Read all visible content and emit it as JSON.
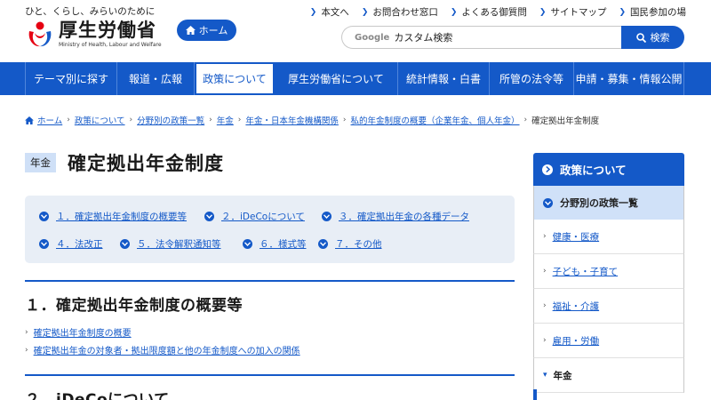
{
  "header": {
    "tagline": "ひと、くらし、みらいのために",
    "logo_main": "厚生労働省",
    "logo_sub": "Ministry of Health, Labour and Welfare",
    "home_label": "ホーム",
    "util_links": [
      "本文へ",
      "お問合わせ窓口",
      "よくある御質問",
      "サイトマップ",
      "国民参加の場"
    ],
    "search_brand": "Google",
    "search_placeholder": "カスタム検索",
    "search_button": "検索"
  },
  "gnav": {
    "items": [
      "テーマ別に探す",
      "報道・広報",
      "政策について",
      "厚生労働省について",
      "統計情報・白書",
      "所管の法令等",
      "申請・募集・情報公開"
    ],
    "active_index": 2
  },
  "breadcrumb": {
    "items": [
      "ホーム",
      "政策について",
      "分野別の政策一覧",
      "年金",
      "年金・日本年金機構関係",
      "私的年金制度の概要（企業年金、個人年金）"
    ],
    "current": "確定拠出年金制度"
  },
  "main": {
    "category": "年金",
    "title": "確定拠出年金制度",
    "toc": [
      "１．確定拠出年金制度の概要等",
      "２．iDeCoについて",
      "３．確定拠出年金の各種データ",
      "４．法改正",
      "５．法令解釈通知等",
      "６．様式等",
      "７．その他"
    ],
    "sections": [
      {
        "heading": "１．確定拠出年金制度の概要等",
        "links": [
          "確定拠出年金制度の概要",
          "確定拠出年金の対象者・拠出限度額と他の年金制度への加入の関係"
        ]
      },
      {
        "heading": "２．iDeCoについて"
      }
    ]
  },
  "side": {
    "head": "政策について",
    "sub": "分野別の政策一覧",
    "items": [
      "健康・医療",
      "子ども・子育て",
      "福祉・介護",
      "雇用・労働",
      "年金"
    ],
    "open_index": 4
  },
  "colors": {
    "accent": "#1459c8",
    "toc_bg": "#e8eef6",
    "sub_bg": "#d0e1f8"
  }
}
